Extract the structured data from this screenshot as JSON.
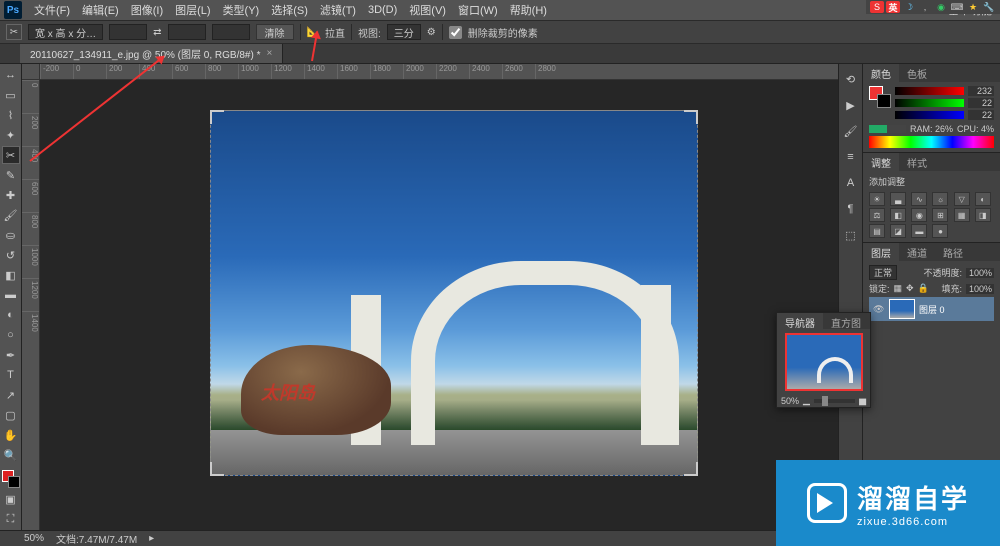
{
  "menubar": {
    "items": [
      "文件(F)",
      "编辑(E)",
      "图像(I)",
      "图层(L)",
      "类型(Y)",
      "选择(S)",
      "滤镜(T)",
      "3D(D)",
      "视图(V)",
      "窗口(W)",
      "帮助(H)"
    ],
    "right": "基本功能"
  },
  "optbar": {
    "ratio_label": "宽 x 高 x 分…",
    "clear": "清除",
    "straighten": "拉直",
    "view_btn": "视图:",
    "rule_of_thirds": "三分",
    "gear": "⚙",
    "delete_cropped": "删除裁剪的像素"
  },
  "tab": {
    "title": "20110627_134911_e.jpg @ 50% (图层 0, RGB/8#) *"
  },
  "ruler_h": [
    "-200",
    "0",
    "200",
    "400",
    "600",
    "800",
    "1000",
    "1200",
    "1400",
    "1600",
    "1800",
    "2000",
    "2200",
    "2400",
    "2600",
    "2800"
  ],
  "ruler_v": [
    "0",
    "200",
    "400",
    "600",
    "800",
    "1000",
    "1200",
    "1400"
  ],
  "right_panels": {
    "color": {
      "tab1": "颜色",
      "tab2": "色板",
      "r": "232",
      "g": "22",
      "b": "22",
      "ram": "RAM: 26%",
      "cpu": "CPU: 4%"
    },
    "adjust": {
      "tab1": "调整",
      "tab2": "样式",
      "title": "添加调整"
    },
    "layers": {
      "tab1": "图层",
      "tab2": "通道",
      "tab3": "路径",
      "blend": "正常",
      "opacity_label": "不透明度:",
      "opacity": "100%",
      "lock_label": "锁定:",
      "fill_label": "填充:",
      "fill": "100%",
      "layer0": "图层 0"
    }
  },
  "navigator": {
    "tab1": "导航器",
    "tab2": "直方图",
    "zoom": "50%"
  },
  "statusbar": {
    "zoom": "50%",
    "doc": "文档:7.47M/7.47M"
  },
  "watermark": {
    "big": "溜溜自学",
    "small": "zixue.3d66.com"
  },
  "photo": {
    "rock_text": "太阳岛"
  }
}
